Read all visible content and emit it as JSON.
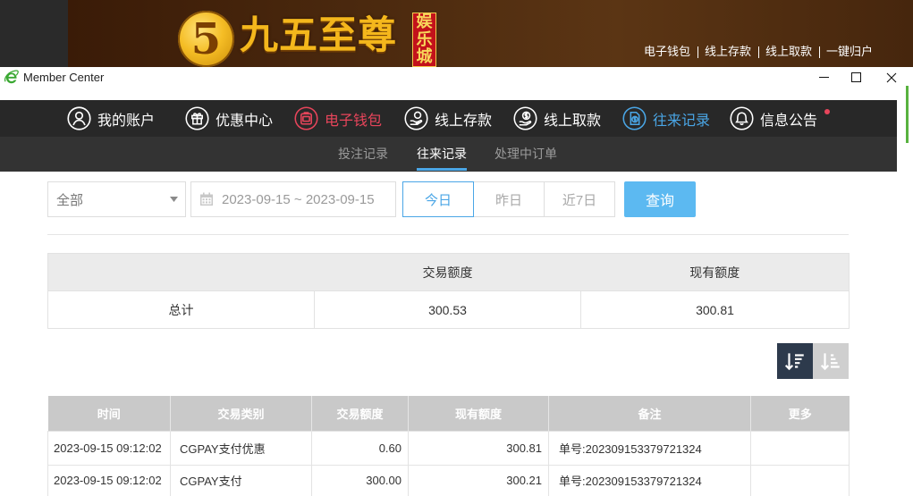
{
  "site_header": {
    "logo_digit": "5",
    "brand_name": "九五至尊",
    "brand_badge": "娱乐城",
    "top_links": [
      {
        "label": "电子钱包"
      },
      {
        "label": "线上存款"
      },
      {
        "label": "线上取款"
      },
      {
        "label": "一键归户"
      }
    ]
  },
  "window": {
    "title": "Member Center",
    "app_icon": "ie-icon",
    "controls": [
      "minimize-icon",
      "maximize-icon",
      "close-icon"
    ]
  },
  "main_nav": {
    "items": [
      {
        "label": "我的账户",
        "icon": "user-icon",
        "highlighted": false,
        "active": false
      },
      {
        "label": "优惠中心",
        "icon": "gift-icon",
        "highlighted": false,
        "active": false
      },
      {
        "label": "电子钱包",
        "icon": "wallet-icon",
        "highlighted": true,
        "active": false
      },
      {
        "label": "线上存款",
        "icon": "deposit-icon",
        "highlighted": false,
        "active": false
      },
      {
        "label": "线上取款",
        "icon": "withdraw-icon",
        "highlighted": false,
        "active": false
      },
      {
        "label": "往来记录",
        "icon": "records-icon",
        "highlighted": false,
        "active": true
      },
      {
        "label": "信息公告",
        "icon": "bell-icon",
        "highlighted": false,
        "active": false,
        "has_notification_dot": true
      }
    ]
  },
  "sub_nav": {
    "tabs": [
      {
        "label": "投注记录",
        "active": false
      },
      {
        "label": "往来记录",
        "active": true
      },
      {
        "label": "处理中订单",
        "active": false
      }
    ]
  },
  "filters": {
    "type_select": {
      "value": "全部",
      "icon": "chevron-down-icon"
    },
    "date_range": {
      "value": "2023-09-15 ~ 2023-09-15",
      "icon": "calendar-icon"
    },
    "quick_ranges": [
      {
        "label": "今日",
        "active": true
      },
      {
        "label": "昨日",
        "active": false
      },
      {
        "label": "近7日",
        "active": false
      }
    ],
    "query_button": "查询"
  },
  "summary_table": {
    "headers": [
      "",
      "交易额度",
      "现有额度"
    ],
    "rows": [
      [
        "总计",
        "300.53",
        "300.81"
      ]
    ]
  },
  "sort_controls": {
    "buttons": [
      {
        "icon": "sort-descending-icon",
        "active": true
      },
      {
        "icon": "sort-ascending-icon",
        "active": false
      }
    ]
  },
  "records_table": {
    "headers": [
      "时间",
      "交易类别",
      "交易额度",
      "现有额度",
      "备注",
      "更多"
    ],
    "rows": [
      [
        "2023-09-15 09:12:02",
        "CGPAY支付优惠",
        "0.60",
        "300.81",
        "单号:202309153379721324",
        ""
      ],
      [
        "2023-09-15 09:12:02",
        "CGPAY支付",
        "300.00",
        "300.21",
        "单号:202309153379721324",
        ""
      ]
    ]
  },
  "colors": {
    "accent": "#4aa6e6",
    "highlight": "#e8455b",
    "query_button": "#5cb9f1",
    "nav_bg": "#282828",
    "subnav_bg": "#333333",
    "brand_gold": "#f4b71c",
    "sort_active_bg": "#2d3a4c",
    "sort_inactive_bg": "#cfcfcf",
    "table_header_bg": "#c9c9c9",
    "summary_header_bg": "#ebebeb"
  }
}
